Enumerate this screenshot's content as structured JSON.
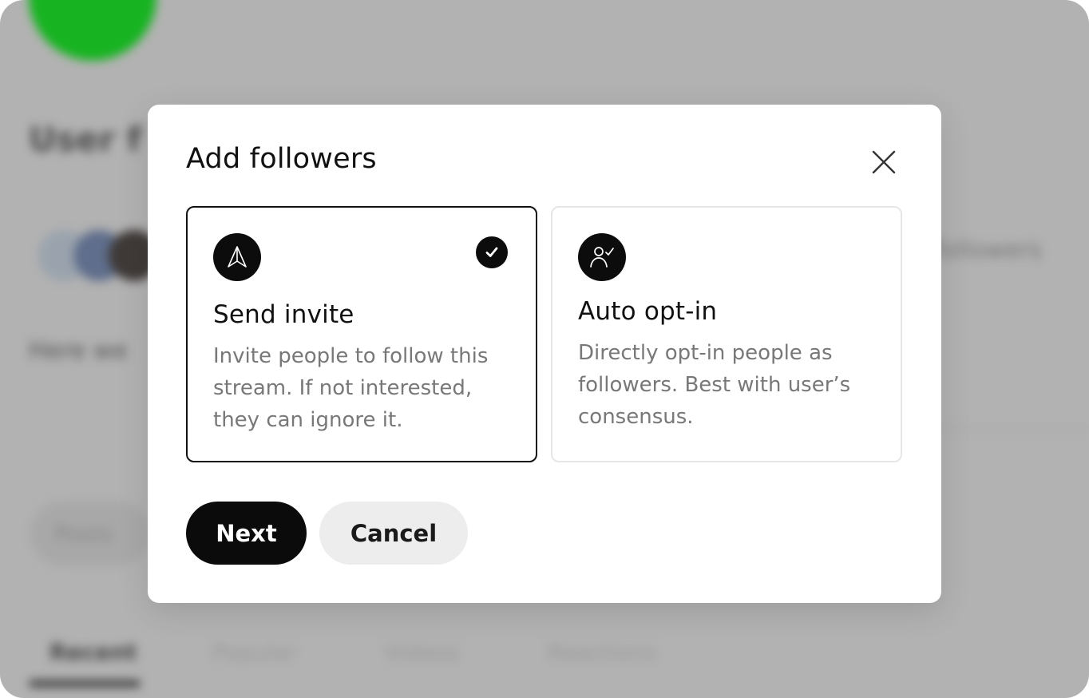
{
  "background": {
    "heading": "User f",
    "text_fragment": "Here we",
    "right_fragment": "followers",
    "field_label": "Posts",
    "tabs": [
      "Recent",
      "Popular",
      "Videos",
      "Reactions"
    ]
  },
  "modal": {
    "title": "Add followers",
    "close_icon": "close-icon",
    "options": [
      {
        "icon": "send-arrow-icon",
        "title": "Send invite",
        "description": "Invite people to follow this stream. If not interested, they can ignore it.",
        "selected": true
      },
      {
        "icon": "person-check-icon",
        "title": "Auto opt-in",
        "description": "Directly opt-in people as followers. Best with user’s consensus.",
        "selected": false
      }
    ],
    "next_label": "Next",
    "cancel_label": "Cancel"
  },
  "colors": {
    "accent": "#0b0b0b",
    "overlay": "#b2b2b2",
    "background_avatar": "#17b321"
  }
}
